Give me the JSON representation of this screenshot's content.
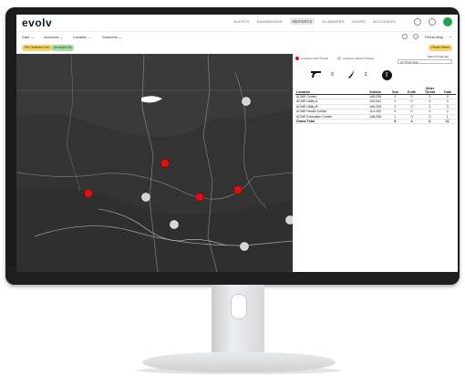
{
  "app": {
    "logo": "evolv",
    "nav": [
      "ALERTS",
      "DASHBOARD",
      "REPORTS",
      "SCANNERS",
      "USERS",
      "ACCOUNTS"
    ],
    "active_nav": "REPORTS"
  },
  "filters": {
    "items": [
      "Date",
      "Accounts",
      "Location",
      "Scanners"
    ],
    "view_label": "Threat Map"
  },
  "chips": {
    "left": [
      "PM Detected Rec",
      "Accepted All"
    ],
    "reset_label": "Reset Filters"
  },
  "map": {
    "markers": [
      {
        "type": "red"
      },
      {
        "type": "red"
      },
      {
        "type": "red"
      },
      {
        "type": "red"
      },
      {
        "type": "gray"
      },
      {
        "type": "gray"
      },
      {
        "type": "gray"
      },
      {
        "type": "gray"
      },
      {
        "type": "gray"
      }
    ],
    "colors": {
      "red": "#e01010",
      "gray": "#d6d6d6",
      "background": "#3a3a3a"
    }
  },
  "panel": {
    "legend": [
      "Locations with Threats",
      "Locations without Threats"
    ],
    "select_label": "Select Threat Tag",
    "select_value": "All Threat Tags",
    "threats": [
      {
        "icon": "gun-icon",
        "value": "9"
      },
      {
        "icon": "knife-icon",
        "value": "2"
      },
      {
        "icon": "other-threat-icon",
        "value": "!"
      }
    ],
    "table": {
      "headers": [
        "Location",
        "Visitors",
        "Gun",
        "Knife",
        "Other Threat",
        "Total"
      ],
      "rows": [
        [
          "ACME Center",
          "148,228",
          "3",
          "0",
          "0",
          "3"
        ],
        [
          "ACME Utility A",
          "120,341",
          "2",
          "0",
          "0",
          "2"
        ],
        [
          "ACME Utility B",
          "148,228",
          "3",
          "0",
          "0",
          "3"
        ],
        [
          "ACME Health Center",
          "114,433",
          "0",
          "2",
          "0",
          "2"
        ],
        [
          "ACME Education Center",
          "148,208",
          "1",
          "0",
          "0",
          "1"
        ]
      ],
      "total": [
        "Grand Total",
        "",
        "9",
        "2",
        "0",
        "11"
      ]
    }
  }
}
